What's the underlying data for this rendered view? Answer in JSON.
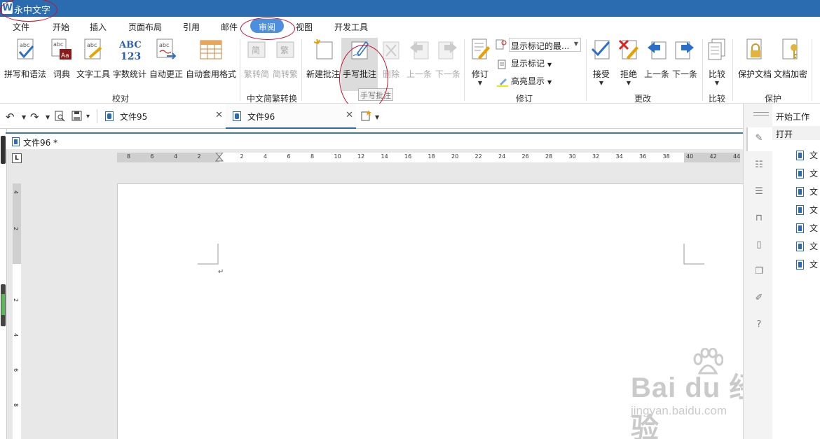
{
  "app": {
    "logo": "W",
    "title": "永中文字"
  },
  "menu": [
    {
      "label": "文件"
    },
    {
      "label": "开始"
    },
    {
      "label": "插入"
    },
    {
      "label": "页面布局"
    },
    {
      "label": "引用"
    },
    {
      "label": "邮件"
    },
    {
      "label": "审阅",
      "active": true
    },
    {
      "label": "视图"
    },
    {
      "label": "开发工具"
    }
  ],
  "ribbon": {
    "groups": {
      "proofing": "校对",
      "chinese_conversion": "中文简繁转换",
      "revision": "修订",
      "changes": "更改",
      "compare": "比较",
      "protect": "保护"
    },
    "buttons": {
      "spelling": "拼写和语法",
      "dictionary": "词典",
      "text_tools": "文字工具",
      "word_count": "字数统计",
      "autocorrect": "自动更正",
      "autoformat": "自动套用格式",
      "trad_to_simp": "繁转简",
      "simp_to_trad": "简转繁",
      "new_comment": "新建批注",
      "handwritten_comment": "手写批注",
      "delete": "删除",
      "previous": "上一条",
      "next": "下一条",
      "track_changes": "修订",
      "accept": "接受",
      "reject": "拒绝",
      "prev_change": "上一条",
      "next_change": "下一条",
      "compare": "比较",
      "protect_doc": "保护文档",
      "encrypt_doc": "文档加密"
    },
    "display_markup_dropdown": "显示标记的最...",
    "show_markup": "显示标记",
    "highlight": "高亮显示",
    "tooltip": "手写批注"
  },
  "tabs": [
    {
      "label": "文件95",
      "active": false
    },
    {
      "label": "文件96",
      "active": true
    }
  ],
  "document": {
    "header_title": "文件96 *",
    "ruler_corner": "L"
  },
  "hruler_ticks": [
    "8",
    "6",
    "4",
    "2",
    "2",
    "4",
    "6",
    "8",
    "10",
    "12",
    "14",
    "16",
    "18",
    "20",
    "22",
    "24",
    "26",
    "28",
    "30",
    "32",
    "34",
    "36",
    "38",
    "40",
    "42",
    "44"
  ],
  "vruler_ticks": [
    "4",
    "2",
    "2",
    "4",
    "6",
    "8"
  ],
  "side_panel": {
    "title": "开始工作",
    "open": "打开",
    "recent": [
      "文",
      "文",
      "文",
      "文",
      "文",
      "文",
      "文"
    ]
  },
  "watermark": {
    "line1": "Bai du 经验",
    "line2": "jingyan.baidu.com"
  }
}
